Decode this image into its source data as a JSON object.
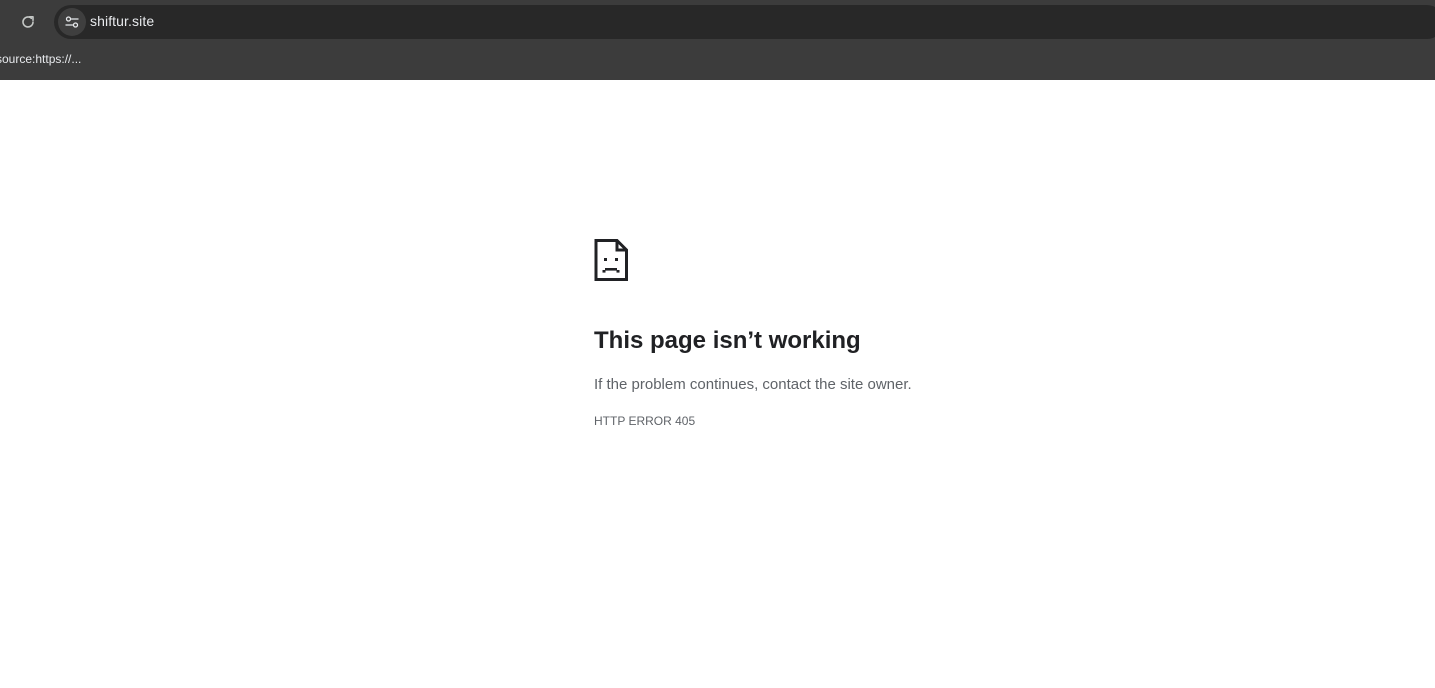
{
  "toolbar": {
    "reload_icon": "reload-icon",
    "site_info_icon": "tune-icon"
  },
  "omnibox": {
    "url": "shiftur.site"
  },
  "bookmarks": {
    "items": [
      {
        "label": "source:https://..."
      }
    ]
  },
  "error_page": {
    "icon": "sad-document-icon",
    "title": "This page isn’t working",
    "description": "If the problem continues, contact the site owner.",
    "code": "HTTP ERROR 405"
  },
  "colors": {
    "chrome_bg": "#3c3c3c",
    "omnibox_bg": "#282828",
    "title_text": "#202124",
    "secondary_text": "#5f6368"
  }
}
